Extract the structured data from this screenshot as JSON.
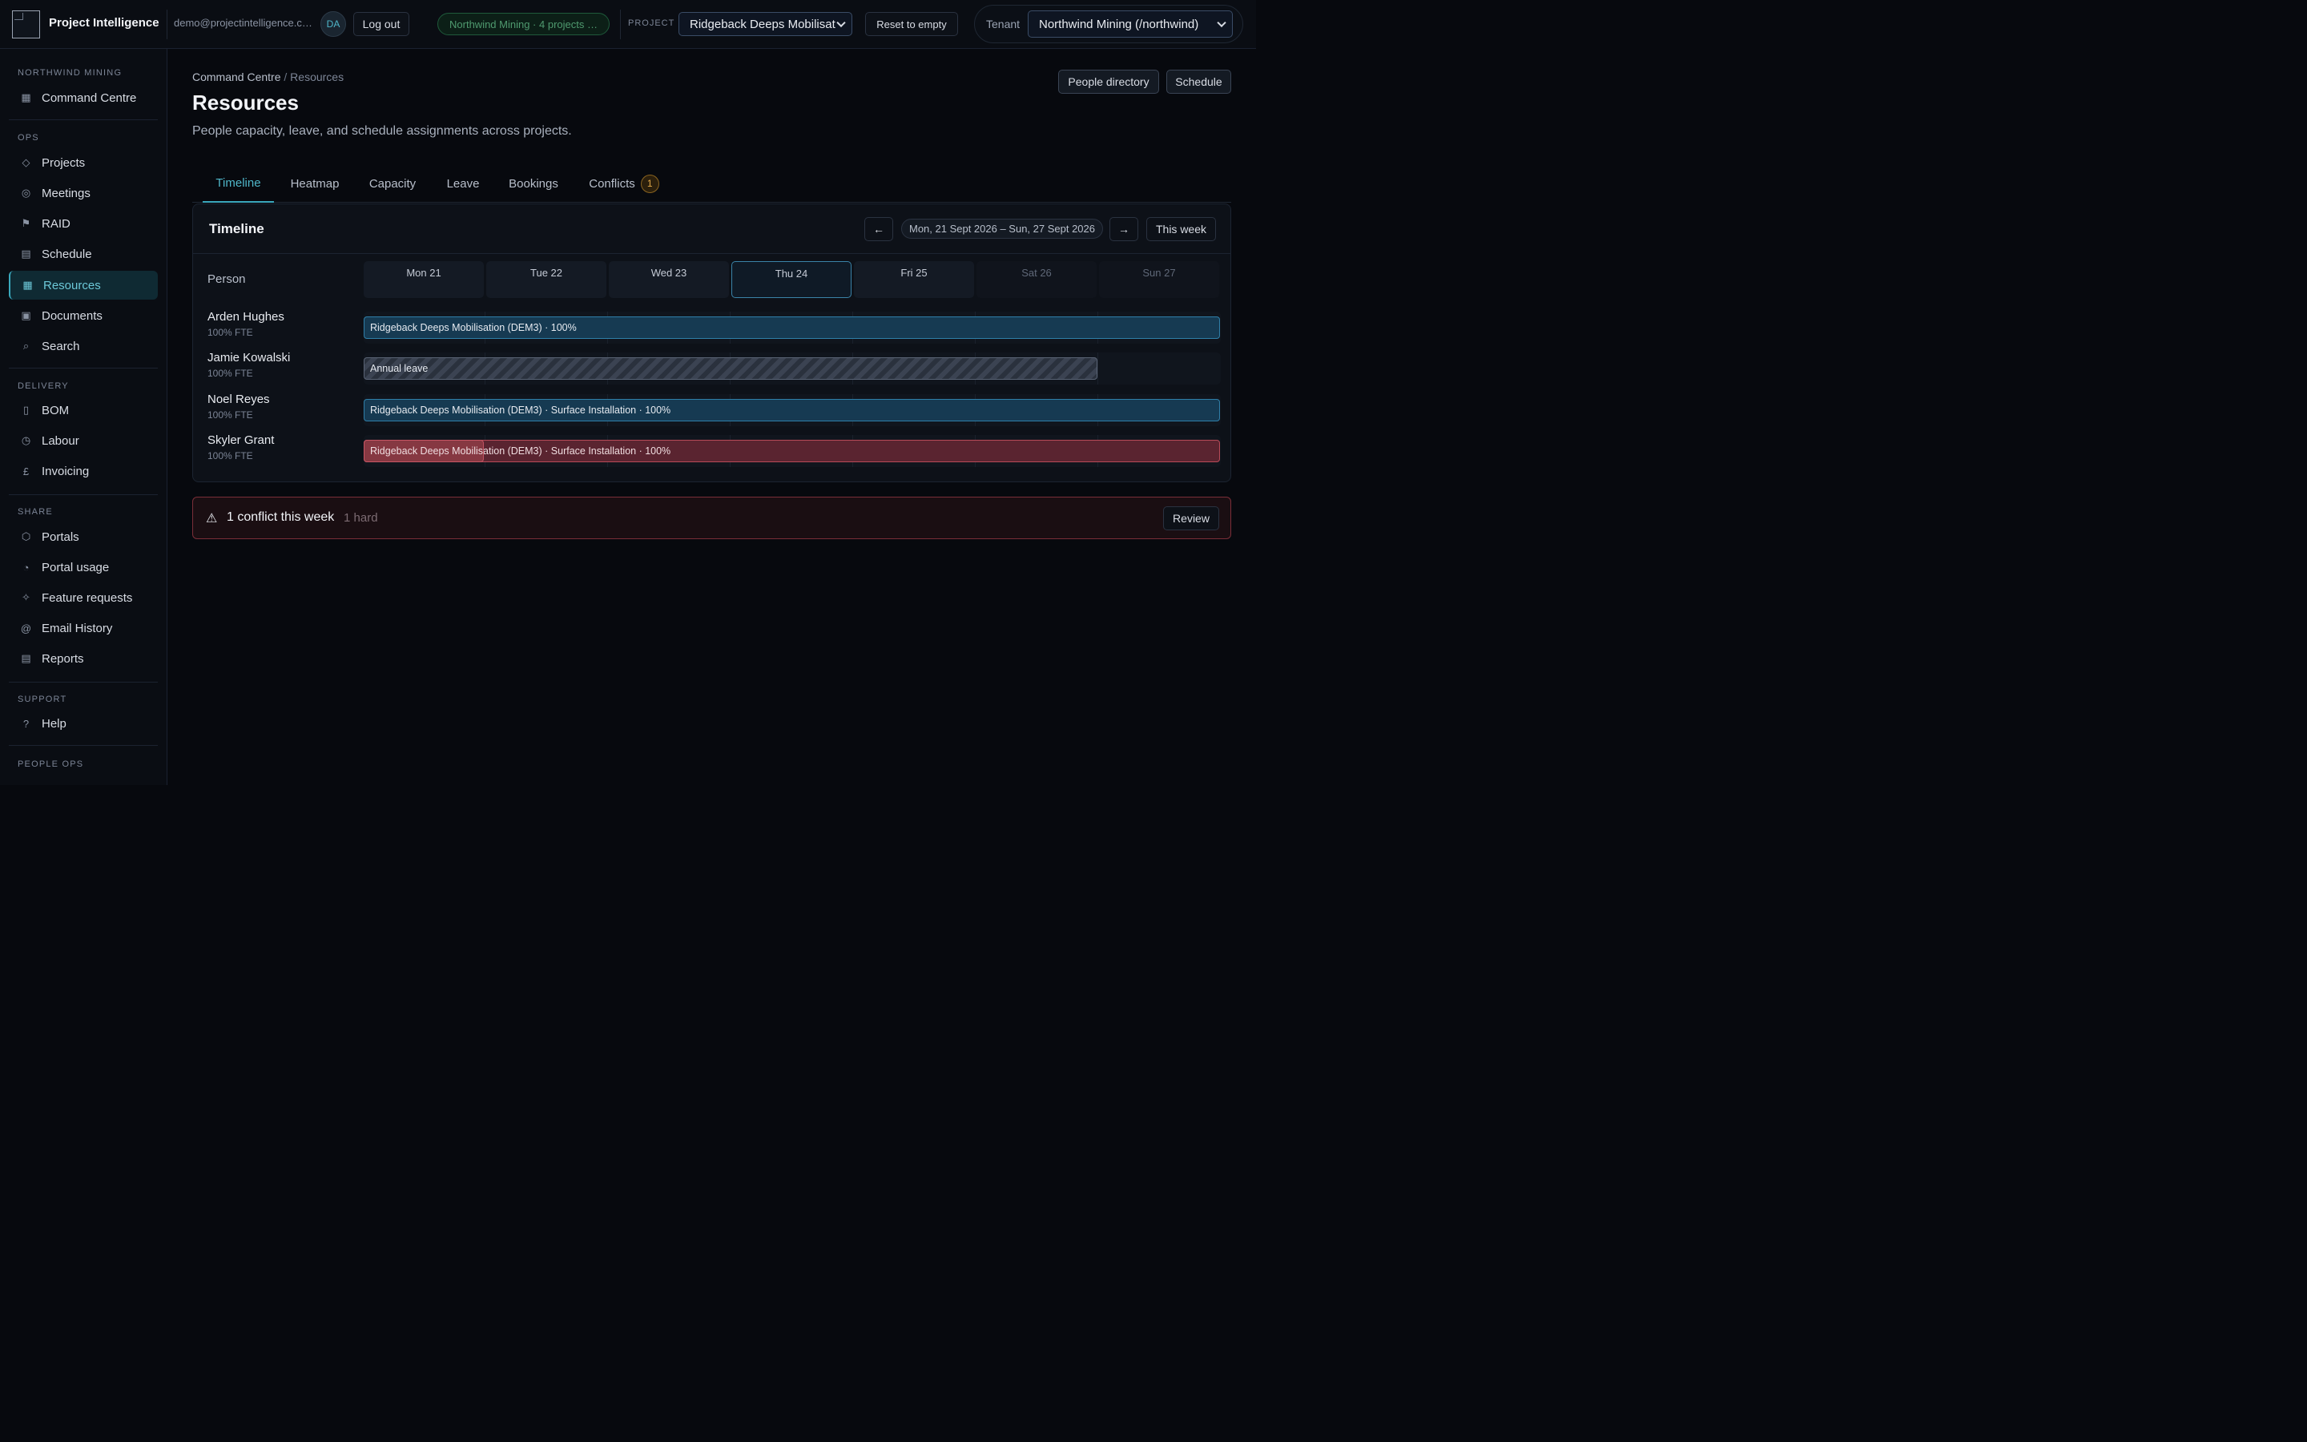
{
  "header": {
    "brand": "Project Intelligence",
    "email": "demo@projectintelligence.com",
    "avatar": "DA",
    "logout": "Log out",
    "tenant_summary": "Northwind Mining · 4 projects …",
    "project_label": "PROJECT",
    "project_value": "Ridgeback Deeps Mobilisat",
    "reset": "Reset to empty",
    "tenant_label": "Tenant",
    "tenant_value": "Northwind Mining (/northwind)"
  },
  "sidebar": {
    "sections": [
      {
        "title": "NORTHWIND MINING",
        "items": [
          {
            "label": "Command Centre",
            "icon": "grid-icon"
          }
        ]
      },
      {
        "title": "OPS",
        "items": [
          {
            "label": "Projects",
            "icon": "diamond-icon"
          },
          {
            "label": "Meetings",
            "icon": "target-icon"
          },
          {
            "label": "RAID",
            "icon": "flag-icon"
          },
          {
            "label": "Schedule",
            "icon": "calendar-icon"
          },
          {
            "label": "Resources",
            "icon": "grid-icon",
            "active": true
          },
          {
            "label": "Documents",
            "icon": "document-icon"
          },
          {
            "label": "Search",
            "icon": "search-icon"
          }
        ]
      },
      {
        "title": "DELIVERY",
        "items": [
          {
            "label": "BOM",
            "icon": "clipboard-icon"
          },
          {
            "label": "Labour",
            "icon": "clock-icon"
          },
          {
            "label": "Invoicing",
            "icon": "pound-icon"
          }
        ]
      },
      {
        "title": "SHARE",
        "items": [
          {
            "label": "Portals",
            "icon": "hexagon-icon"
          },
          {
            "label": "Portal usage",
            "icon": "pie-icon"
          },
          {
            "label": "Feature requests",
            "icon": "sparkle-icon"
          },
          {
            "label": "Email History",
            "icon": "at-icon"
          },
          {
            "label": "Reports",
            "icon": "report-icon"
          }
        ]
      },
      {
        "title": "SUPPORT",
        "items": [
          {
            "label": "Help",
            "icon": "help-icon"
          }
        ]
      },
      {
        "title": "PEOPLE OPS",
        "items": []
      }
    ]
  },
  "page": {
    "breadcrumb_root": "Command Centre",
    "breadcrumb_sep": "/",
    "breadcrumb_current": "Resources",
    "title": "Resources",
    "subtitle": "People capacity, leave, and schedule assignments across projects.",
    "people_directory": "People directory",
    "schedule": "Schedule"
  },
  "tabs": [
    {
      "label": "Timeline",
      "active": true
    },
    {
      "label": "Heatmap"
    },
    {
      "label": "Capacity"
    },
    {
      "label": "Leave"
    },
    {
      "label": "Bookings"
    },
    {
      "label": "Conflicts",
      "badge": "1"
    }
  ],
  "timeline": {
    "title": "Timeline",
    "prev": "←",
    "next": "→",
    "range": "Mon, 21 Sept 2026 – Sun, 27 Sept 2026",
    "this_week": "This week",
    "person_header": "Person",
    "days": [
      {
        "label": "Mon 21"
      },
      {
        "label": "Tue 22"
      },
      {
        "label": "Wed 23"
      },
      {
        "label": "Thu 24",
        "today": true
      },
      {
        "label": "Fri 25"
      },
      {
        "label": "Sat 26",
        "weekend": true
      },
      {
        "label": "Sun 27",
        "weekend": true
      }
    ],
    "people": [
      {
        "name": "Arden Hughes",
        "fte": "100% FTE",
        "bars": [
          {
            "type": "assign",
            "label": "Ridgeback Deeps Mobilisation (DEM3) · 100%",
            "start": 0,
            "days": 7
          }
        ]
      },
      {
        "name": "Jamie Kowalski",
        "fte": "100% FTE",
        "bars": [
          {
            "type": "leave",
            "label": "Annual leave",
            "start": 0,
            "days": 6
          }
        ]
      },
      {
        "name": "Noel Reyes",
        "fte": "100% FTE",
        "bars": [
          {
            "type": "assign",
            "label": "Ridgeback Deeps Mobilisation (DEM3) · Surface Installation · 100%",
            "start": 0,
            "days": 7
          }
        ]
      },
      {
        "name": "Skyler Grant",
        "fte": "100% FTE",
        "bars": [
          {
            "type": "conflict",
            "label": "Ridgeback Deeps Mobilisation (DEM3) · Surface Installation · 100%",
            "start": 0,
            "days": 7
          },
          {
            "type": "conflict-short",
            "label": "Ridgeback Deeps Mobilisation",
            "start": 0,
            "days": 1
          }
        ]
      }
    ]
  },
  "conflicts": {
    "icon": "warning-icon",
    "title": "1 conflict this week",
    "sub": "1 hard",
    "review": "Review"
  }
}
